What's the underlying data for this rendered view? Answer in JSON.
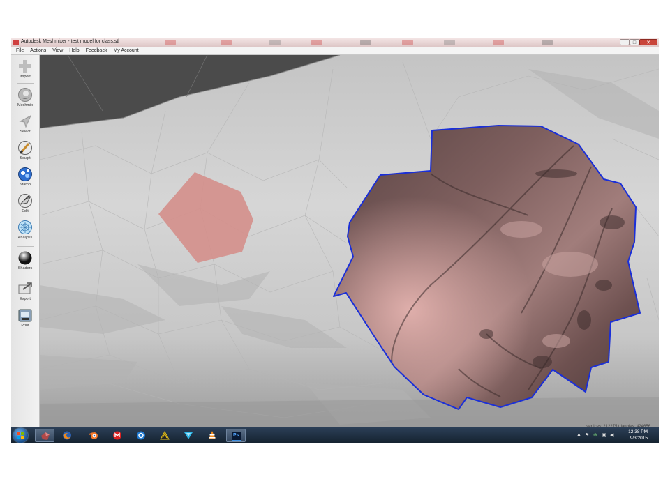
{
  "window": {
    "title": "Autodesk Meshmixer - test model for class.stl",
    "controls": {
      "minimize": "–",
      "maximize": "□",
      "close": "✕"
    }
  },
  "menu": [
    "File",
    "Actions",
    "View",
    "Help",
    "Feedback",
    "My Account"
  ],
  "toolbar": {
    "import": "Import",
    "meshmix": "Meshmix",
    "select": "Select",
    "sculpt": "Sculpt",
    "stamp": "Stamp",
    "edit": "Edit",
    "analysis": "Analysis",
    "shaders": "Shaders",
    "export": "Export",
    "print": "Print"
  },
  "viewport": {
    "stats": "vertices: 212275  triangles: 424656",
    "colors": {
      "mesh": "#c9c9c9",
      "selection_small": "#d4908c",
      "selection_outline": "#1a2fd8",
      "selection_fill": "#a07a78"
    }
  },
  "taskbar": {
    "apps": [
      "meshmixer-icon",
      "firefox-icon",
      "blender-icon",
      "makerbot-icon",
      "app-o-icon",
      "winamp-icon",
      "cura-icon",
      "vlc-icon",
      "photoshop-icon"
    ],
    "photoshop_label": "Ps",
    "clock": {
      "time": "12:38 PM",
      "date": "9/3/2015"
    }
  }
}
